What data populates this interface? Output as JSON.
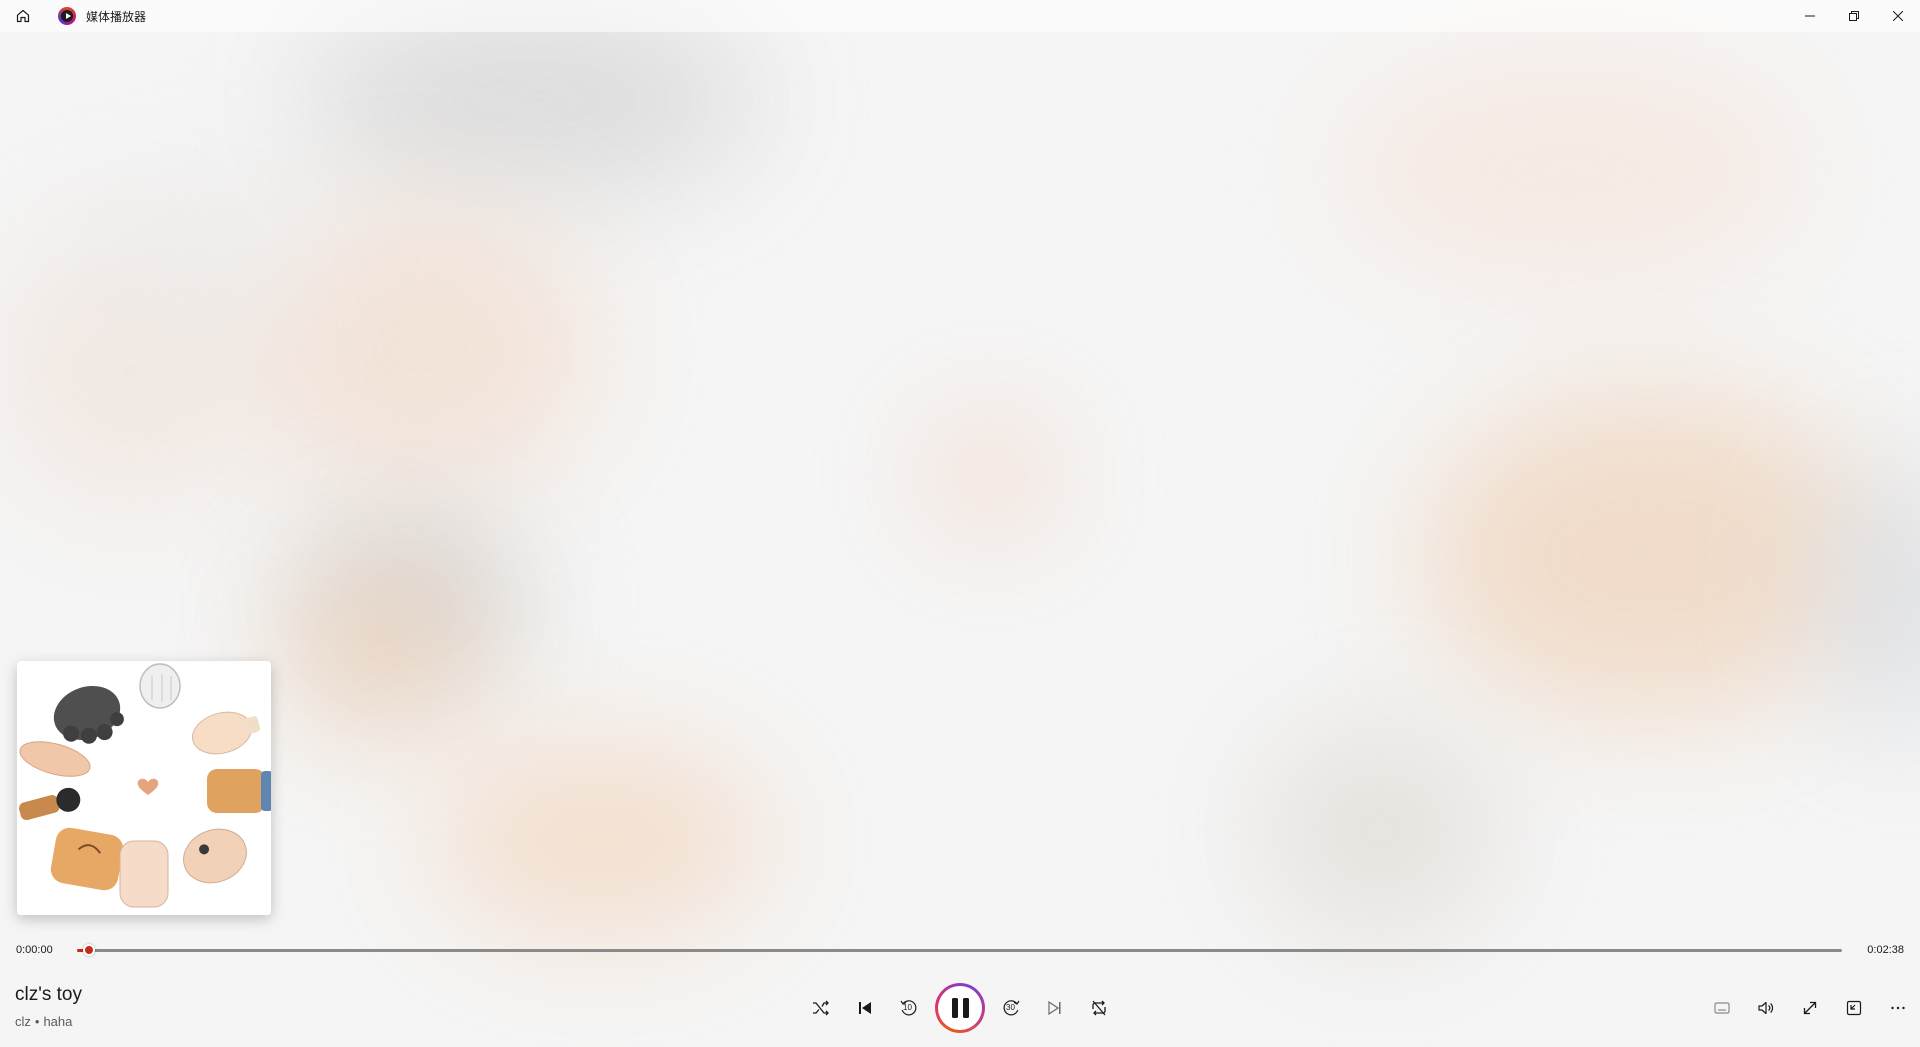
{
  "titlebar": {
    "app_title": "媒体播放器"
  },
  "player": {
    "current_time": "0:00:00",
    "total_time": "0:02:38",
    "progress": 0.007,
    "accent_color": "#c42b1c",
    "track": {
      "title": "clz's toy",
      "artist": "clz",
      "separator": "•",
      "album": "haha"
    }
  },
  "icons": {
    "home": "home-icon",
    "app": "media-player-icon",
    "minimize": "minimize-icon",
    "restore": "restore-icon",
    "close": "close-icon",
    "shuffle": "shuffle-icon",
    "previous": "previous-icon",
    "skip_back": "skip-back-10-icon",
    "pause": "pause-icon",
    "skip_forward": "skip-forward-30-icon",
    "next": "next-icon",
    "repeat": "repeat-icon",
    "captions": "captions-icon",
    "volume": "volume-icon",
    "fullscreen": "fullscreen-icon",
    "miniplayer": "miniplayer-icon",
    "more": "more-icon"
  },
  "controls": {
    "skip_back_label": "10",
    "skip_forward_label": "30"
  }
}
